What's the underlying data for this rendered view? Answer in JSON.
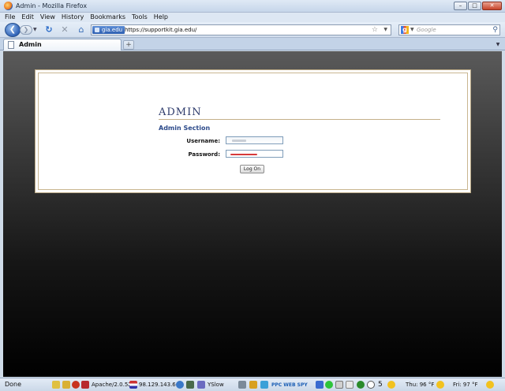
{
  "window": {
    "title": "Admin - Mozilla Firefox",
    "controls": [
      "–",
      "□",
      "✕"
    ]
  },
  "menu": [
    "File",
    "Edit",
    "View",
    "History",
    "Bookmarks",
    "Tools",
    "Help"
  ],
  "nav": {
    "back_glyph": "❮",
    "forward_glyph": "❯",
    "reload_glyph": "↻",
    "stop_glyph": "✕",
    "home_glyph": "⌂",
    "site_identity": "gia.edu",
    "url": "https://supportkit.gia.edu/",
    "bookmark_star_glyph": "☆",
    "search_engine_glyph": "g",
    "search_placeholder": "Google",
    "search_glyph": "⚲"
  },
  "tabs": {
    "active_label": "Admin",
    "new_tab_glyph": "+"
  },
  "page": {
    "heading": "ADMIN",
    "section_title": "Admin Section",
    "username_label": "Username:",
    "password_label": "Password:",
    "logon_label": "Log On"
  },
  "status": {
    "text": "Done",
    "server": "Apache/2.0.52",
    "ip": "98.129.143.66",
    "yslow": "YSlow",
    "ppc": "PPC WEB SPY",
    "count": "5",
    "weather_thu": "Thu: 96 °F",
    "weather_fri": "Fri: 97 °F"
  },
  "colors": {
    "heading": "#2c3a6b",
    "section": "#2c4a8a",
    "panel_border": "#c4b08a"
  }
}
